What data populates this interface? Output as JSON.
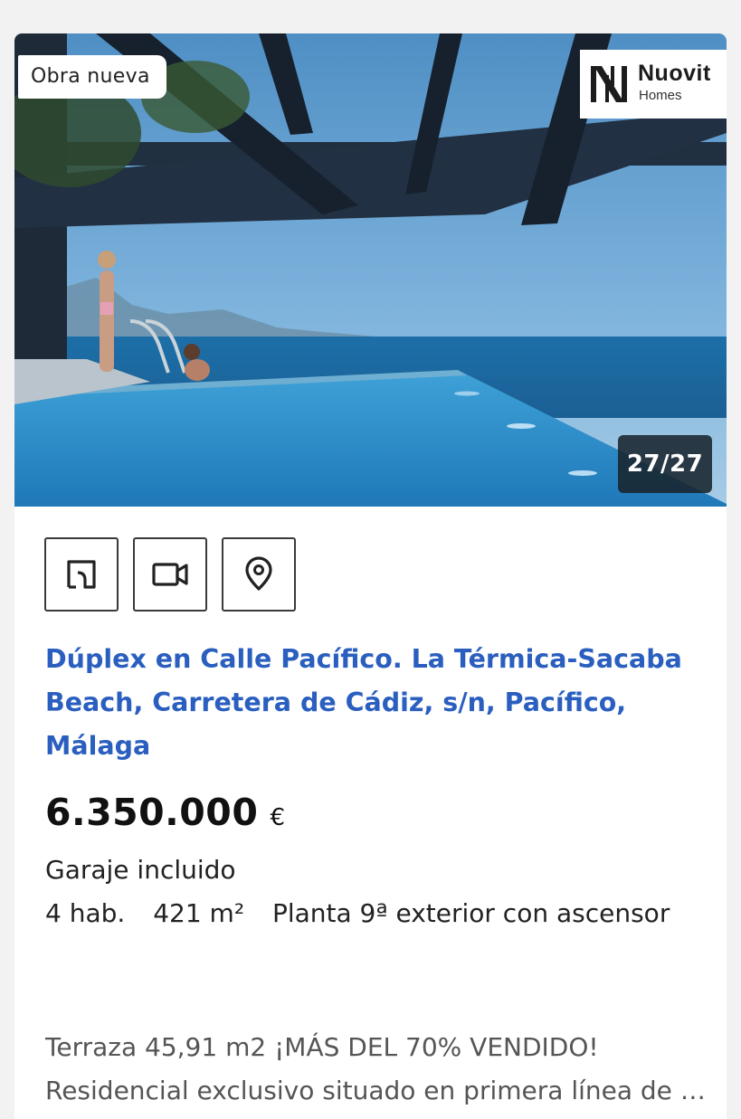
{
  "listing": {
    "badge": "Obra nueva",
    "agency": {
      "name": "Nuovit",
      "subtitle": "Homes"
    },
    "photo_counter": "27/27",
    "actions": [
      {
        "icon": "floor-plan-icon",
        "label": "Plano"
      },
      {
        "icon": "video-camera-icon",
        "label": "Vídeo"
      },
      {
        "icon": "map-pin-icon",
        "label": "Mapa"
      }
    ],
    "title": "Dúplex en Calle Pacífico. La Térmica-Sacaba Beach, Carretera de Cádiz, s/n, Pacífico, Málaga",
    "price": "6.350.000",
    "currency": "€",
    "garage": "Garaje incluido",
    "rooms": "4 hab.",
    "area": "421 m²",
    "floor": "Planta 9ª exterior con ascensor",
    "description_line1": "Terraza 45,91 m2 ¡MÁS DEL 70% VENDIDO!",
    "description_line2": "Residencial exclusivo situado en primera línea de playa"
  },
  "colors": {
    "title_link": "#2a5fbf",
    "counter_bg": "#18242e",
    "page_bg": "#f2f2f2"
  }
}
